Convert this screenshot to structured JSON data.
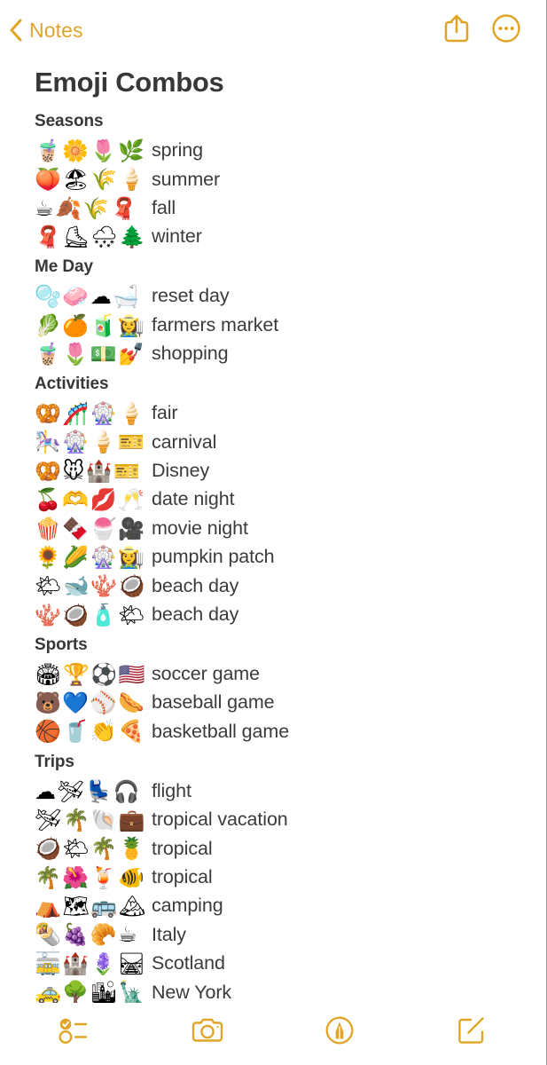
{
  "accent_color": "#E0A526",
  "text_color": "#3b3b3d",
  "navbar": {
    "back_label": "Notes",
    "back_icon": "chevron-left-icon",
    "share_icon": "share-icon",
    "more_icon": "more-circle-icon"
  },
  "note": {
    "title": "Emoji Combos",
    "sections": [
      {
        "header": "Seasons",
        "rows": [
          {
            "emojis": "🧋🌼🌷🌿",
            "label": "spring"
          },
          {
            "emojis": "🍑🏖🌾🍦",
            "label": "summer"
          },
          {
            "emojis": "☕🍂🌾🧣",
            "label": "fall"
          },
          {
            "emojis": "🧣⛸🌨🌲",
            "label": "winter"
          }
        ]
      },
      {
        "header": "Me Day",
        "rows": [
          {
            "emojis": "🫧🧼☁🛁",
            "label": "reset day"
          },
          {
            "emojis": "🥬🍊🧃👩‍🌾",
            "label": "farmers market"
          },
          {
            "emojis": "🧋🌷💵💅",
            "label": "shopping"
          }
        ]
      },
      {
        "header": "Activities",
        "rows": [
          {
            "emojis": "🥨🎢🎡🍦",
            "label": "fair"
          },
          {
            "emojis": "🎠🎡🍦🎫",
            "label": "carnival"
          },
          {
            "emojis": "🥨🐭🏰🎫",
            "label": "Disney"
          },
          {
            "emojis": "🍒🫶💋🥂",
            "label": "date night"
          },
          {
            "emojis": "🍿🍫🍧🎥",
            "label": "movie night"
          },
          {
            "emojis": "🌻🌽🎡👩‍🌾",
            "label": "pumpkin patch"
          },
          {
            "emojis": "🌤🐋🪸🥥",
            "label": "beach day"
          },
          {
            "emojis": "🪸🥥🧴🌤",
            "label": "beach day"
          }
        ]
      },
      {
        "header": "Sports",
        "rows": [
          {
            "emojis": "🏟🏆⚽🇺🇸",
            "label": "soccer game"
          },
          {
            "emojis": "🐻💙⚾🌭",
            "label": "baseball game"
          },
          {
            "emojis": "🏀🥤👏🍕",
            "label": "basketball game"
          }
        ]
      },
      {
        "header": "Trips",
        "rows": [
          {
            "emojis": "☁🛩💺🎧",
            "label": "flight"
          },
          {
            "emojis": "🛩🌴🐚💼",
            "label": "tropical vacation"
          },
          {
            "emojis": "🥥🌤🌴🍍",
            "label": "tropical"
          },
          {
            "emojis": "🌴🌺🍹🐠",
            "label": "tropical"
          },
          {
            "emojis": "⛺🗺🚌🏔",
            "label": "camping"
          },
          {
            "emojis": "🌯🍇🥐☕",
            "label": "Italy"
          },
          {
            "emojis": "🚋🏰🪻🛤",
            "label": "Scotland"
          },
          {
            "emojis": "🚕🌳🏙🗽",
            "label": "New York"
          }
        ]
      }
    ]
  },
  "toolbar": {
    "checklist_icon": "checklist-icon",
    "camera_icon": "camera-icon",
    "markup_icon": "markup-pen-icon",
    "compose_icon": "compose-icon"
  }
}
